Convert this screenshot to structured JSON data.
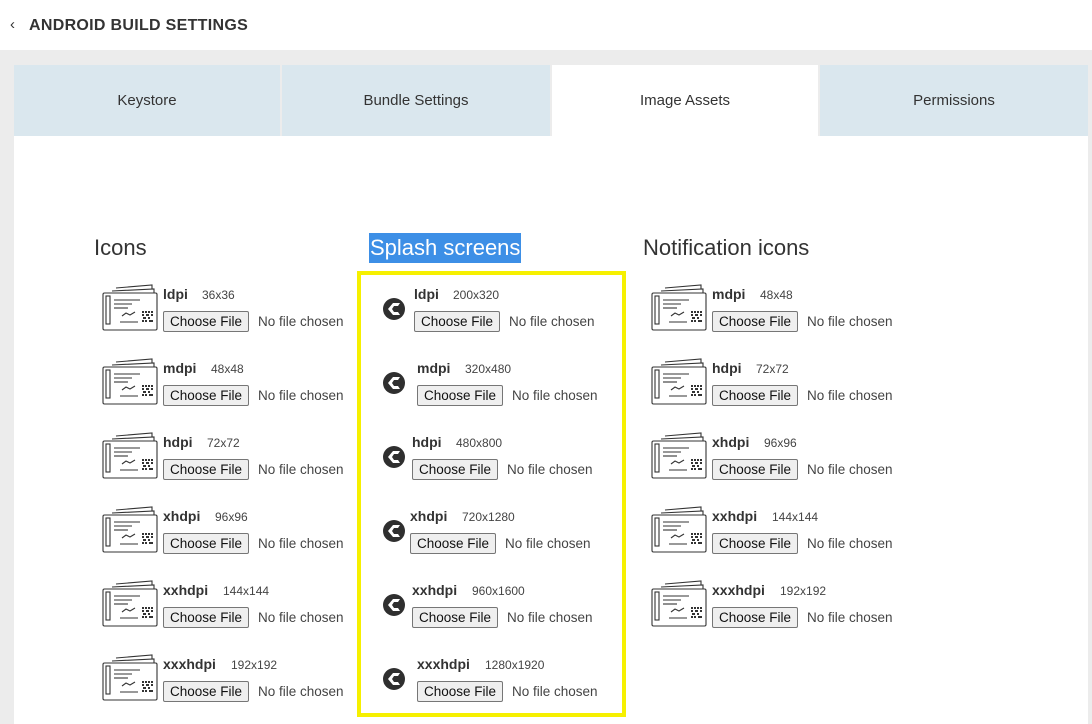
{
  "header": {
    "back_icon": "chevron-left-icon",
    "title": "ANDROID BUILD SETTINGS"
  },
  "tabs": [
    {
      "label": "Keystore",
      "active": false
    },
    {
      "label": "Bundle Settings",
      "active": false
    },
    {
      "label": "Image Assets",
      "active": true
    },
    {
      "label": "Permissions",
      "active": false
    }
  ],
  "icons": {
    "title": "Icons",
    "items": [
      {
        "density": "ldpi",
        "size": "36x36",
        "button": "Choose File",
        "status": "No file chosen"
      },
      {
        "density": "mdpi",
        "size": "48x48",
        "button": "Choose File",
        "status": "No file chosen"
      },
      {
        "density": "hdpi",
        "size": "72x72",
        "button": "Choose File",
        "status": "No file chosen"
      },
      {
        "density": "xhdpi",
        "size": "96x96",
        "button": "Choose File",
        "status": "No file chosen"
      },
      {
        "density": "xxhdpi",
        "size": "144x144",
        "button": "Choose File",
        "status": "No file chosen"
      },
      {
        "density": "xxxhdpi",
        "size": "192x192",
        "button": "Choose File",
        "status": "No file chosen"
      }
    ]
  },
  "splash": {
    "title": "Splash screens",
    "items": [
      {
        "density": "ldpi",
        "size": "200x320",
        "button": "Choose File",
        "status": "No file chosen"
      },
      {
        "density": "mdpi",
        "size": "320x480",
        "button": "Choose File",
        "status": "No file chosen"
      },
      {
        "density": "hdpi",
        "size": "480x800",
        "button": "Choose File",
        "status": "No file chosen"
      },
      {
        "density": "xhdpi",
        "size": "720x1280",
        "button": "Choose File",
        "status": "No file chosen"
      },
      {
        "density": "xxhdpi",
        "size": "960x1600",
        "button": "Choose File",
        "status": "No file chosen"
      },
      {
        "density": "xxxhdpi",
        "size": "1280x1920",
        "button": "Choose File",
        "status": "No file chosen"
      }
    ]
  },
  "notification": {
    "title": "Notification icons",
    "items": [
      {
        "density": "mdpi",
        "size": "48x48",
        "button": "Choose File",
        "status": "No file chosen"
      },
      {
        "density": "hdpi",
        "size": "72x72",
        "button": "Choose File",
        "status": "No file chosen"
      },
      {
        "density": "xhdpi",
        "size": "96x96",
        "button": "Choose File",
        "status": "No file chosen"
      },
      {
        "density": "xxhdpi",
        "size": "144x144",
        "button": "Choose File",
        "status": "No file chosen"
      },
      {
        "density": "xxxhdpi",
        "size": "192x192",
        "button": "Choose File",
        "status": "No file chosen"
      }
    ]
  },
  "colors": {
    "tab_bg": "#dae7ee",
    "highlight": "#3d8fe6",
    "focus_box": "#f6f000"
  }
}
